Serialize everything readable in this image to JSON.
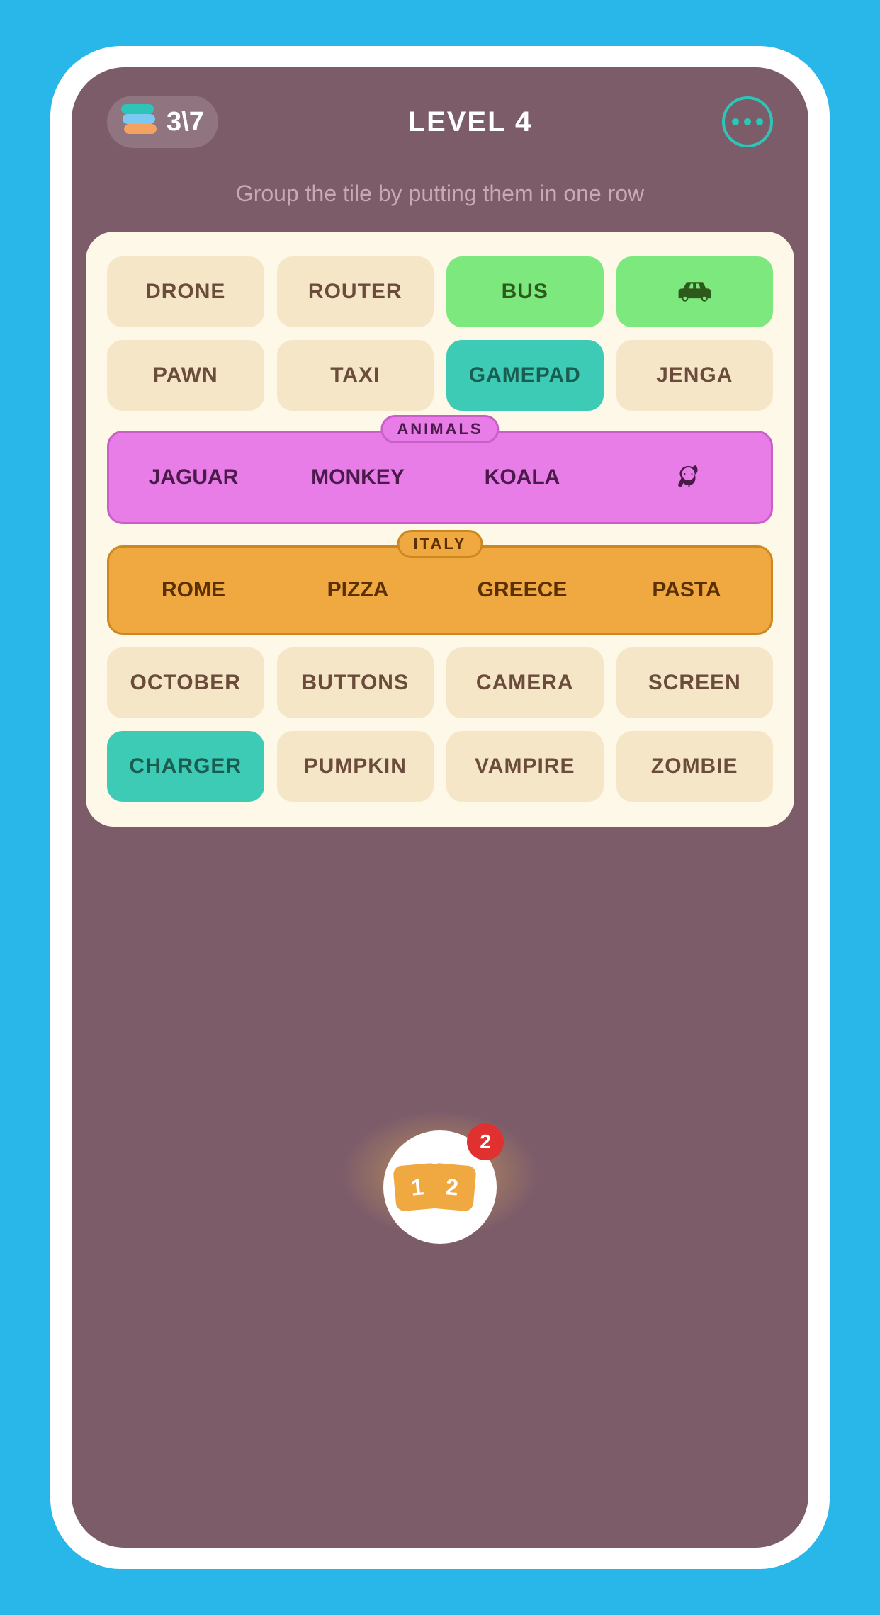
{
  "header": {
    "score": "3\\7",
    "level": "LEVEL 4",
    "menu_label": "menu"
  },
  "instruction": {
    "text": "Group the tile by putting them\nin one row"
  },
  "board": {
    "regular_tiles": [
      {
        "id": "drone",
        "label": "DRONE",
        "style": "cream"
      },
      {
        "id": "router",
        "label": "ROUTER",
        "style": "cream"
      },
      {
        "id": "bus",
        "label": "BUS",
        "style": "green"
      },
      {
        "id": "car",
        "label": "CAR_ICON",
        "style": "green"
      },
      {
        "id": "pawn",
        "label": "PAWN",
        "style": "cream"
      },
      {
        "id": "taxi",
        "label": "TAXI",
        "style": "cream"
      },
      {
        "id": "gamepad",
        "label": "GAMEPAD",
        "style": "teal"
      },
      {
        "id": "jenga",
        "label": "JENGA",
        "style": "cream"
      }
    ],
    "groups": [
      {
        "id": "animals",
        "label": "ANIMALS",
        "tiles": [
          {
            "id": "jaguar",
            "label": "JAGUAR"
          },
          {
            "id": "monkey",
            "label": "MONKEY"
          },
          {
            "id": "koala",
            "label": "KOALA"
          },
          {
            "id": "elephant",
            "label": "ELEPHANT_ICON"
          }
        ]
      },
      {
        "id": "italy",
        "label": "ITALY",
        "tiles": [
          {
            "id": "rome",
            "label": "ROME"
          },
          {
            "id": "pizza",
            "label": "PIZZA"
          },
          {
            "id": "greece",
            "label": "GREECE"
          },
          {
            "id": "pasta",
            "label": "PASTA"
          }
        ]
      }
    ],
    "bottom_tiles": [
      {
        "id": "october",
        "label": "OCTOBER",
        "style": "cream"
      },
      {
        "id": "buttons",
        "label": "BUTTONS",
        "style": "cream"
      },
      {
        "id": "camera",
        "label": "CAMERA",
        "style": "cream"
      },
      {
        "id": "screen",
        "label": "SCREEN",
        "style": "cream"
      },
      {
        "id": "charger",
        "label": "CHARGER",
        "style": "teal"
      },
      {
        "id": "pumpkin",
        "label": "PUMPKIN",
        "style": "cream"
      },
      {
        "id": "vampire",
        "label": "VAMPIRE",
        "style": "cream"
      },
      {
        "id": "zombie",
        "label": "ZOMBIE",
        "style": "cream"
      }
    ]
  },
  "hint": {
    "count": "2"
  }
}
